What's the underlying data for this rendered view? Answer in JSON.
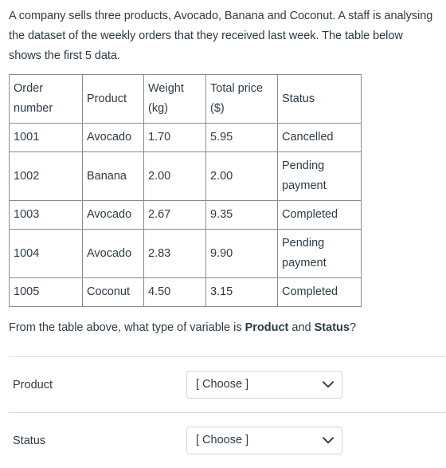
{
  "question": {
    "stem": "A company sells three products, Avocado, Banana and Coconut. A staff is analysing the dataset of the weekly orders that they received last week. The table below shows the first 5 data.",
    "followup_prefix": "From the table above, what type of variable is ",
    "followup_bold_1": "Product",
    "followup_middle": " and ",
    "followup_bold_2": "Status",
    "followup_suffix": "?"
  },
  "table": {
    "headers": [
      "Order number",
      "Product",
      "Weight (kg)",
      "Total price ($)",
      "Status"
    ],
    "rows": [
      {
        "order_number": "1001",
        "product": "Avocado",
        "weight": "1.70",
        "total_price": "5.95",
        "status": "Cancelled"
      },
      {
        "order_number": "1002",
        "product": "Banana",
        "weight": "2.00",
        "total_price": "2.00",
        "status": "Pending payment"
      },
      {
        "order_number": "1003",
        "product": "Avocado",
        "weight": "2.67",
        "total_price": "9.35",
        "status": "Completed"
      },
      {
        "order_number": "1004",
        "product": "Avocado",
        "weight": "2.83",
        "total_price": "9.90",
        "status": "Pending payment"
      },
      {
        "order_number": "1005",
        "product": "Coconut",
        "weight": "4.50",
        "total_price": "3.15",
        "status": "Completed"
      }
    ]
  },
  "answers": [
    {
      "label": "Product",
      "selected": "[ Choose ]",
      "icon": "chevron-down-icon"
    },
    {
      "label": "Status",
      "selected": "[ Choose ]",
      "icon": "chevron-down-icon"
    }
  ],
  "colors": {
    "text": "#2d3b45",
    "table_border": "#8b8b8b",
    "divider": "#dcdcdc",
    "select_border": "#d4d6d8"
  }
}
